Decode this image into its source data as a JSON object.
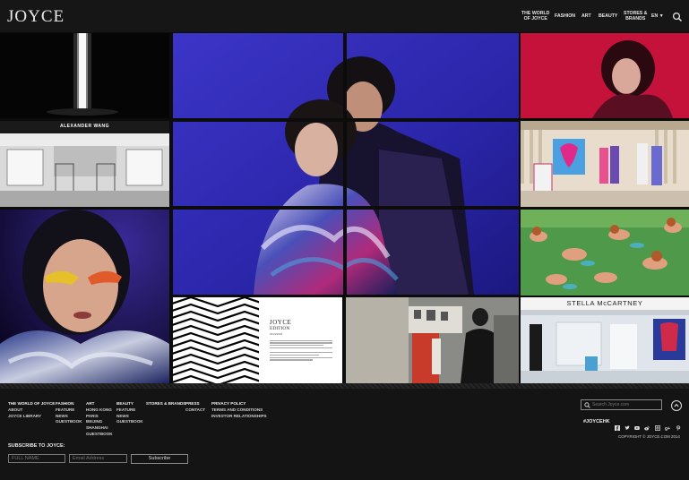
{
  "header": {
    "logo": "JOYCE",
    "nav": [
      {
        "line1": "THE WORLD",
        "line2": "OF JOYCE"
      },
      {
        "line1": "FASHION",
        "line2": ""
      },
      {
        "line1": "ART",
        "line2": ""
      },
      {
        "line1": "BEAUTY",
        "line2": ""
      },
      {
        "line1": "STORES &",
        "line2": "BRANDS"
      },
      {
        "line1": "EN ▼",
        "line2": ""
      }
    ]
  },
  "tiles": {
    "alexander_wang_sign": "ALEXANDER WANG",
    "edition": {
      "brand": "JOYCE",
      "subtitle": "EDITION",
      "date_line": "2014/2015"
    },
    "stella_sign": "STELLA McCARTNEY"
  },
  "footer": {
    "columns": [
      [
        "THE WORLD OF JOYCE",
        "ABOUT",
        "JOYCE LIBRARY"
      ],
      [
        "FASHION",
        "FEATURE",
        "NEWS",
        "GUESTBOOK"
      ],
      [
        "ART",
        "HONG KONG",
        "PARIS",
        "BEIJING",
        "SHANGHAI",
        "GUESTBOOK"
      ],
      [
        "BEAUTY",
        "FEATURE",
        "NEWS",
        "GUESTBOOK"
      ],
      [
        "STORES & BRANDS"
      ],
      [
        "PRESS",
        "CONTACT"
      ],
      [
        "PRIVACY POLICY",
        "TERMS AND CONDITIONS",
        "INVESTOR RELATIONSHIPS"
      ]
    ],
    "subscribe_title": "SUBSCRIBE TO JOYCE:",
    "full_name_placeholder": "FULL NAME",
    "email_placeholder": "Email Address",
    "subscribe_button": "Subscribe",
    "search_placeholder": "Search Joyce.com",
    "hashtag": "#JOYCEHK",
    "social_icons": [
      "facebook-icon",
      "twitter-icon",
      "youtube-icon",
      "weibo-icon",
      "instagram-icon",
      "googleplus-icon",
      "pinterest-icon"
    ],
    "copyright": "COPYRIGHT © JOYCE.COM 2014"
  }
}
